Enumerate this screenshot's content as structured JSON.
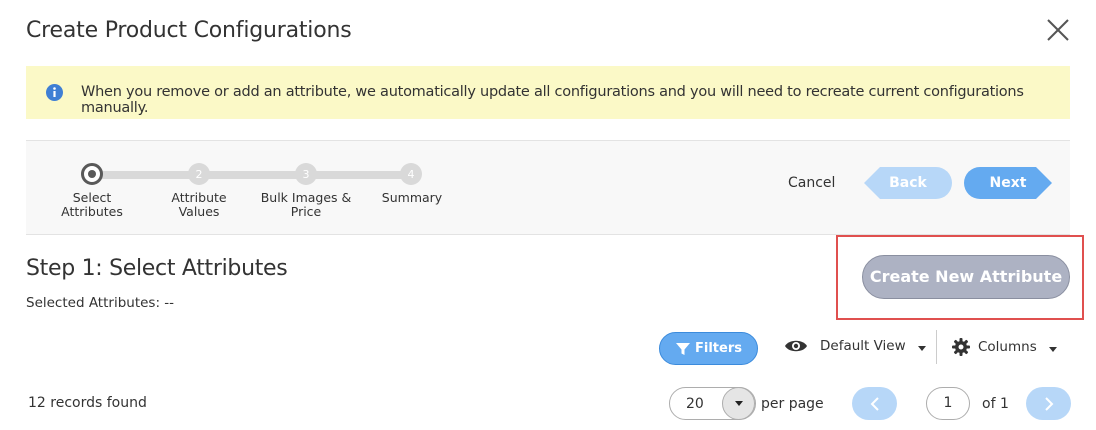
{
  "modal": {
    "title": "Create Product Configurations",
    "close_icon": "close-icon"
  },
  "notice": {
    "icon": "info-icon",
    "message": "When you remove or add an attribute, we automatically update all configurations and you will need to recreate current configurations manually."
  },
  "wizard": {
    "steps": [
      {
        "number": "1",
        "label_line1": "Select",
        "label_line2": "Attributes",
        "active": true
      },
      {
        "number": "2",
        "label_line1": "Attribute",
        "label_line2": "Values",
        "active": false
      },
      {
        "number": "3",
        "label_line1": "Bulk Images &",
        "label_line2": "Price",
        "active": false
      },
      {
        "number": "4",
        "label_line1": "Summary",
        "label_line2": "",
        "active": false
      }
    ],
    "cancel_label": "Cancel",
    "back_label": "Back",
    "next_label": "Next"
  },
  "content": {
    "heading": "Step 1: Select Attributes",
    "selected_attributes": "Selected Attributes: --",
    "create_attribute_label": "Create New Attribute"
  },
  "toolbar": {
    "filters_label": "Filters",
    "view_label": "Default View",
    "columns_label": "Columns"
  },
  "grid": {
    "records_found": "12 records found",
    "per_page_value": "20",
    "per_page_label": "per page",
    "current_page": "1",
    "total_pages_label": "of 1"
  },
  "colors": {
    "notice_bg": "#fbf9c7",
    "primary_blue": "#64aaf0",
    "disabled_blue": "#b7d7f8",
    "highlight_red": "#e0504f",
    "create_btn_bg": "#adb2c3"
  }
}
